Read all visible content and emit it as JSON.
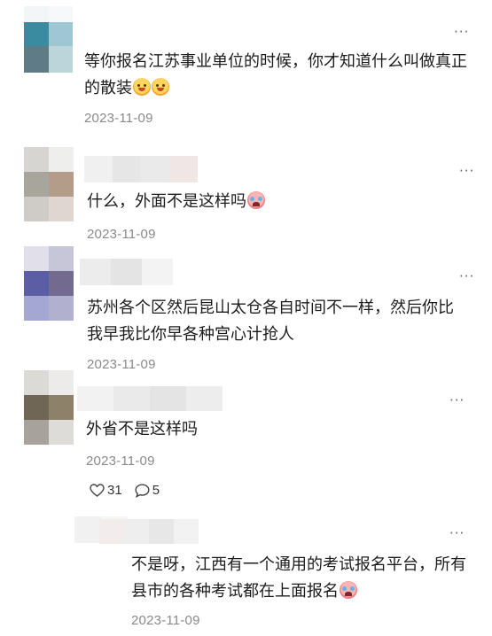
{
  "comments": [
    {
      "text": "等你报名江苏事业单位的时候，你才知道什么叫做真正的散装",
      "emojis": [
        "smile-emoji",
        "smile-emoji"
      ],
      "date": "2023-11-09",
      "more": "···",
      "avatar_colors": [
        "#3a8aa0",
        "#9fc7d3",
        "#5f7c86",
        "#bcd5da"
      ],
      "name_colors": [
        "#e8ecee",
        "#f4f6f7"
      ]
    },
    {
      "text": "什么，外面不是这样吗",
      "emojis": [
        "crying-emoji"
      ],
      "date": "2023-11-09",
      "more": "···",
      "avatar_colors": [
        "#d7d5d1",
        "#eeeeec",
        "#a7a59c",
        "#b39c8a",
        "#cfcbc7",
        "#e0d6d1"
      ],
      "name_colors": [
        "#f0f0f0",
        "#e6e6e6",
        "#eaeaea",
        "#f1e6e6"
      ]
    },
    {
      "text": "苏州各个区然后昆山太仓各自时间不一样，然后你比我早我比你早各种宫心计抢人",
      "emojis": [],
      "date": "2023-11-09",
      "more": "···",
      "avatar_colors": [
        "#e1e0ea",
        "#c7c5d8",
        "#5b5ea5",
        "#736a8f",
        "#a3a7d2",
        "#b1b0cf"
      ],
      "name_colors": [
        "#ececec",
        "#e4e4e4",
        "#f3f3f3"
      ]
    },
    {
      "text": "外省不是这样吗",
      "emojis": [],
      "date": "2023-11-09",
      "more": "···",
      "avatar_colors": [
        "#dcdad7",
        "#ecebe9",
        "#6f6655",
        "#8d8269",
        "#a7a39c",
        "#dedcd8"
      ],
      "name_colors": [
        "#f2f2f2",
        "#eaeaea",
        "#e4e4e4",
        "#ededed"
      ],
      "likes": "31",
      "replies": "5"
    },
    {
      "text": "不是呀，江西有一个通用的考试报名平台，所有县市的各种考试都在上面报名",
      "emojis": [
        "crying-emoji"
      ],
      "date": "2023-11-09",
      "more": "···",
      "avatar_colors": [
        "#f1f1f1",
        "#f7f7f7"
      ],
      "name_colors": [
        "#f3ecec",
        "#eeeeee",
        "#e7e7e7",
        "#f2f2f2"
      ]
    }
  ]
}
